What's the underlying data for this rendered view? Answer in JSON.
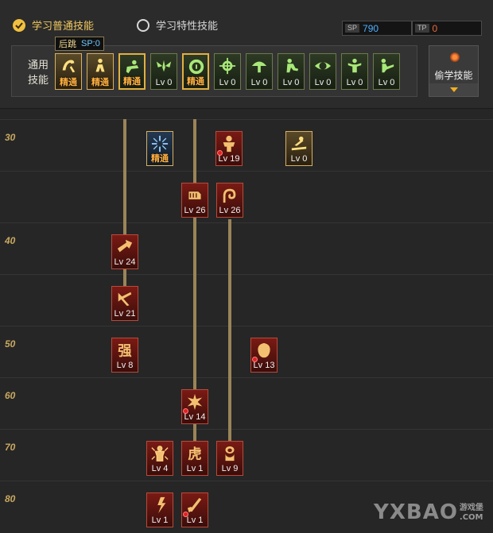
{
  "tabs": [
    {
      "label": "学习普通技能",
      "active": true
    },
    {
      "label": "学习特性技能",
      "active": false
    }
  ],
  "sp": {
    "blue": {
      "tag": "SP",
      "value": "790"
    },
    "red": {
      "tag": "TP",
      "value": "0"
    }
  },
  "tooltip": {
    "name": "后跳",
    "sp": "SP:0"
  },
  "common": {
    "label": "通用技能",
    "skills": [
      {
        "level": "精通",
        "icon": "backflip-icon"
      },
      {
        "level": "精通",
        "icon": "crouch-icon"
      },
      {
        "level": "精通",
        "icon": "dash-icon"
      },
      {
        "level": "Lv 0",
        "icon": "wing-icon"
      },
      {
        "level": "精通",
        "icon": "target-icon"
      },
      {
        "level": "Lv 0",
        "icon": "crosshair-icon"
      },
      {
        "level": "Lv 0",
        "icon": "mushroom-icon"
      },
      {
        "level": "Lv 0",
        "icon": "kneel-icon"
      },
      {
        "level": "Lv 0",
        "icon": "eye-icon"
      },
      {
        "level": "Lv 0",
        "icon": "power-icon"
      },
      {
        "level": "Lv 0",
        "icon": "kick-icon"
      }
    ]
  },
  "steal": {
    "label": "偷学技能"
  },
  "levels": [
    "30",
    "40",
    "50",
    "60",
    "70",
    "80"
  ],
  "tree": [
    {
      "level": "精通",
      "icon": "burst-icon"
    },
    {
      "level": "Lv 19",
      "icon": "warrior-icon"
    },
    {
      "level": "Lv 0",
      "icon": "slide-icon"
    },
    {
      "level": "Lv 26",
      "icon": "fist-icon"
    },
    {
      "level": "Lv 26",
      "icon": "swirl-icon"
    },
    {
      "level": "Lv 24",
      "icon": "arrow-icon"
    },
    {
      "level": "Lv 21",
      "icon": "slash-icon"
    },
    {
      "level": "Lv 8",
      "icon": "strength-glyph-icon",
      "glyph": "强"
    },
    {
      "level": "Lv 13",
      "icon": "mask-icon"
    },
    {
      "level": "Lv 14",
      "icon": "explosion-icon"
    },
    {
      "level": "Lv 4",
      "icon": "aura-icon"
    },
    {
      "level": "Lv 1",
      "icon": "tiger-glyph-icon",
      "glyph": "虎"
    },
    {
      "level": "Lv 9",
      "icon": "knot-icon"
    },
    {
      "level": "Lv 1",
      "icon": "spark-icon"
    },
    {
      "level": "Lv 1",
      "icon": "blade-icon"
    }
  ],
  "watermark": {
    "main": "YXBAO",
    "sub1": "游戏堡",
    "sub2": ".COM"
  }
}
